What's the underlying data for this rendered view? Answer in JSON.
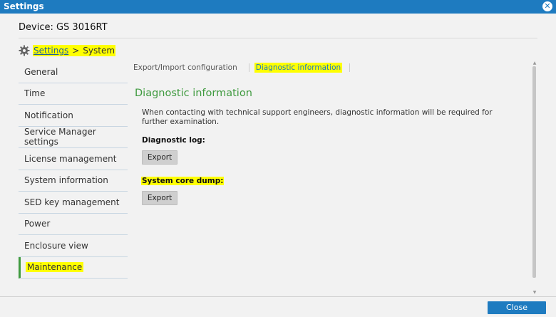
{
  "window": {
    "title": "Settings",
    "close_icon": "close-circle-icon"
  },
  "device": {
    "label": "Device: GS 3016RT"
  },
  "breadcrumb": {
    "icon": "gear-icon",
    "parent": "Settings",
    "separator": ">",
    "current": "System"
  },
  "sidebar": {
    "items": [
      {
        "label": "General"
      },
      {
        "label": "Time"
      },
      {
        "label": "Notification"
      },
      {
        "label": "Service Manager settings"
      },
      {
        "label": "License management"
      },
      {
        "label": "System information"
      },
      {
        "label": "SED key management"
      },
      {
        "label": "Power"
      },
      {
        "label": "Enclosure view"
      },
      {
        "label": "Maintenance",
        "active": true
      }
    ]
  },
  "tabs": [
    {
      "label": "Export/Import configuration"
    },
    {
      "label": "Diagnostic information",
      "active": true
    }
  ],
  "content": {
    "title": "Diagnostic information",
    "description": "When contacting with technical support engineers, diagnostic information will be required for further examination.",
    "diagnostic_log_label": "Diagnostic log:",
    "diagnostic_log_button": "Export",
    "core_dump_label": "System core dump:",
    "core_dump_button": "Export"
  },
  "footer": {
    "close_label": "Close"
  },
  "colors": {
    "titlebar": "#1e7bc0",
    "accent_green": "#3f9a3f",
    "highlight": "#ffff00"
  }
}
